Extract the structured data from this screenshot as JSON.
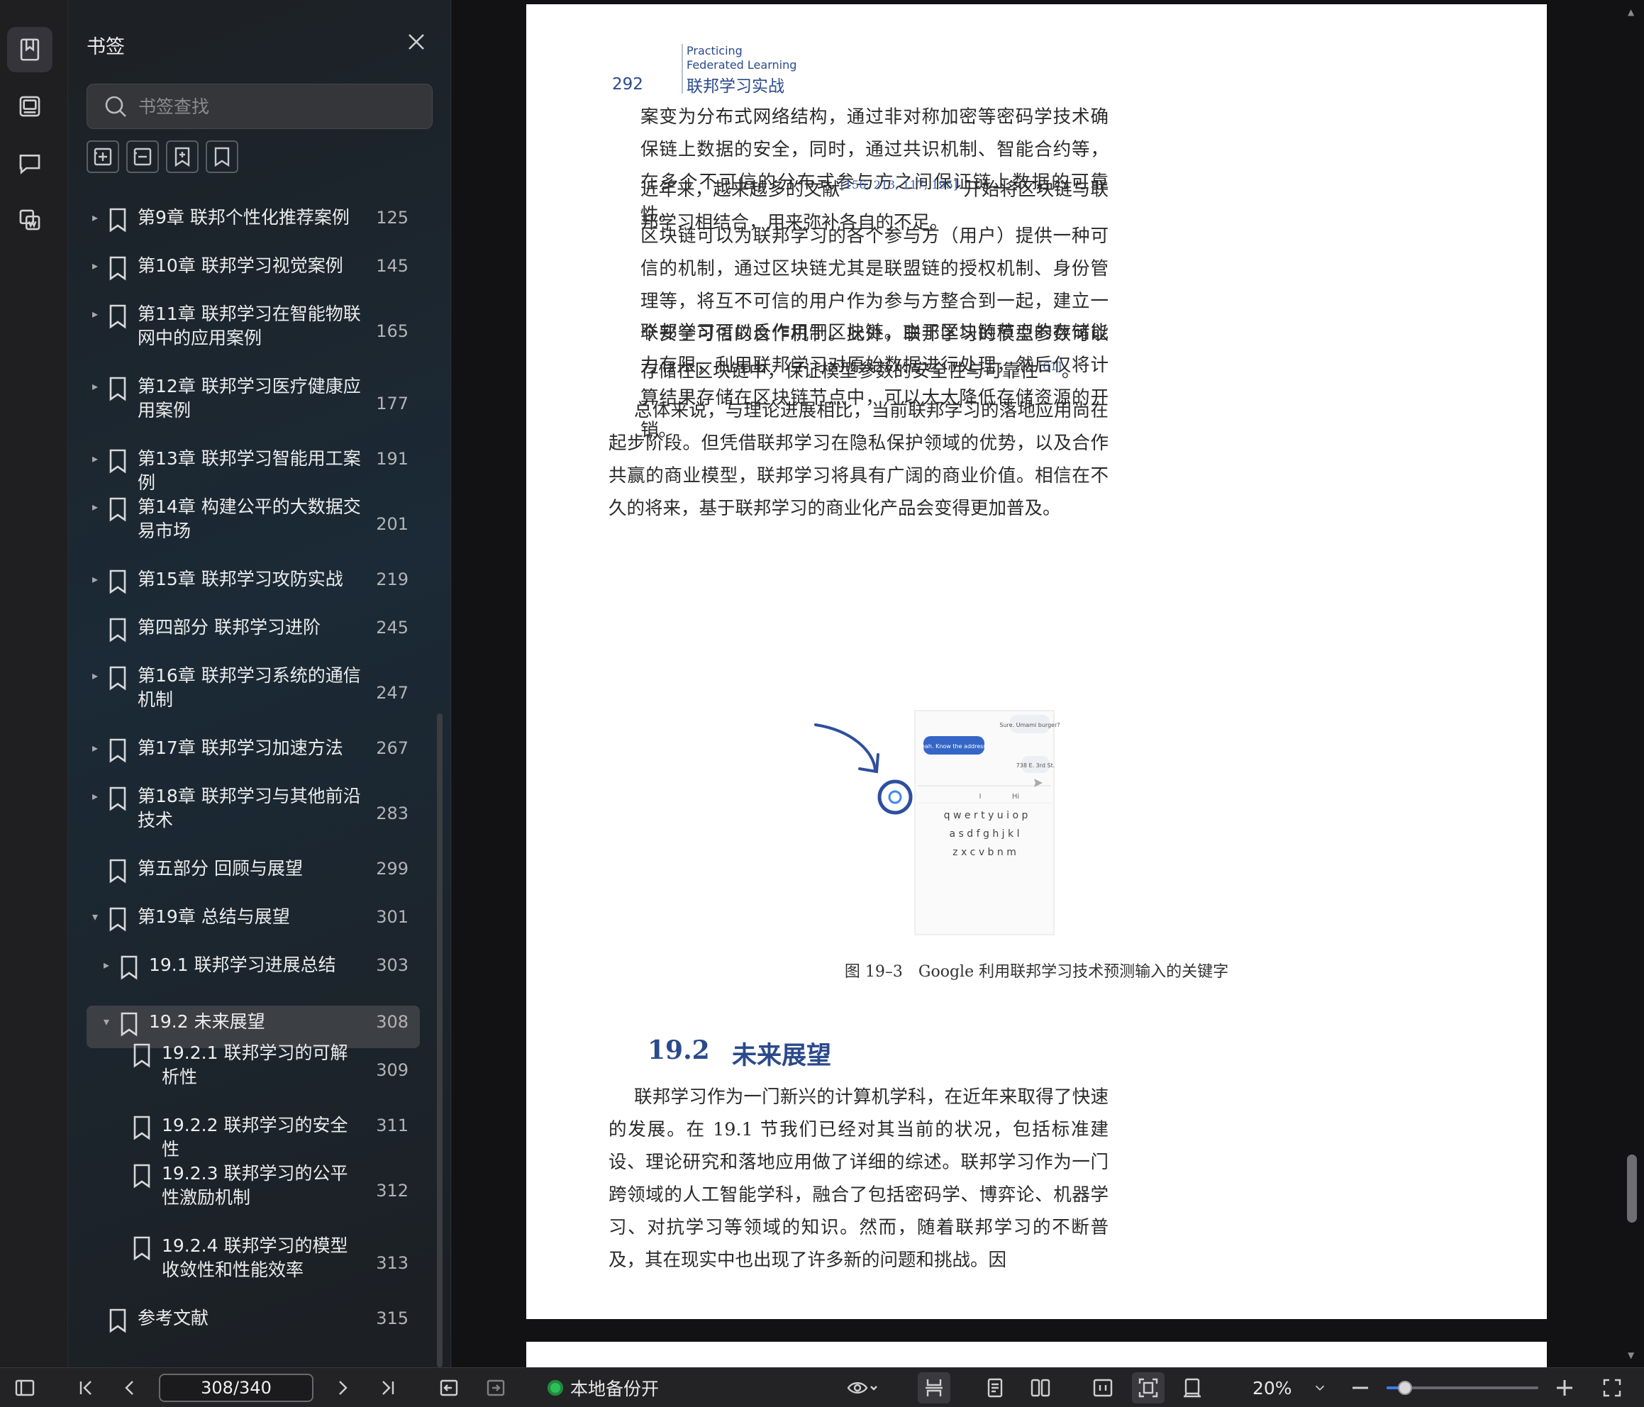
{
  "panel": {
    "title": "书签",
    "search_placeholder": "书签查找",
    "bookmarks": [
      {
        "label": "第9章 联邦个性化推荐案例",
        "page": "125",
        "arrow": "▸"
      },
      {
        "label": "第10章 联邦学习视觉案例",
        "page": "145",
        "arrow": "▸"
      },
      {
        "label": "第11章 联邦学习在智能物联网中的应用案例",
        "page": "165",
        "arrow": "▸"
      },
      {
        "label": "第12章 联邦学习医疗健康应用案例",
        "page": "177",
        "arrow": "▸"
      },
      {
        "label": "第13章 联邦学习智能用工案例",
        "page": "191",
        "arrow": "▸"
      },
      {
        "label": "第14章 构建公平的大数据交易市场",
        "page": "201",
        "arrow": "▸"
      },
      {
        "label": "第15章 联邦学习攻防实战",
        "page": "219",
        "arrow": "▸"
      },
      {
        "label": "第四部分 联邦学习进阶",
        "page": "245",
        "arrow": ""
      },
      {
        "label": "第16章 联邦学习系统的通信机制",
        "page": "247",
        "arrow": "▸"
      },
      {
        "label": "第17章 联邦学习加速方法",
        "page": "267",
        "arrow": "▸"
      },
      {
        "label": "第18章 联邦学习与其他前沿技术",
        "page": "283",
        "arrow": "▸"
      },
      {
        "label": "第五部分 回顾与展望",
        "page": "299",
        "arrow": ""
      },
      {
        "label": "第19章 总结与展望",
        "page": "301",
        "arrow": "▾"
      },
      {
        "label": "19.1 联邦学习进展总结",
        "page": "303",
        "arrow": "▸"
      },
      {
        "label": "19.2 未来展望",
        "page": "308",
        "arrow": "▾"
      },
      {
        "label": "19.2.1 联邦学习的可解析性",
        "page": "309",
        "arrow": ""
      },
      {
        "label": "19.2.2 联邦学习的安全性",
        "page": "311",
        "arrow": ""
      },
      {
        "label": "19.2.3 联邦学习的公平性激励机制",
        "page": "312",
        "arrow": ""
      },
      {
        "label": "19.2.4 联邦学习的模型收敛性和性能效率",
        "page": "313",
        "arrow": ""
      },
      {
        "label": "参考文献",
        "page": "315",
        "arrow": ""
      }
    ]
  },
  "document": {
    "page_number": "292",
    "header_en_1": "Practicing",
    "header_en_2": "Federated Learning",
    "header_zh": "联邦学习实战",
    "p1": "案变为分布式网络结构，通过非对称加密等密码学技术确保链上数据的安全，同时，通过共识机制、智能合约等，在多个不可信的分布式参与方之间保证链上数据的可靠性。",
    "p2_a": "近年来，越来越多的文献",
    "p2_ref": "[156, 213, 117, 195]",
    "p2_b": " 开始将区块链与联邦学习相结合，用来弥补各自的不足。",
    "p3_a": "区块链可以为联邦学习的各个参与方（用户）提供一种可信的机制，通过区块链尤其是联盟链的授权机制、身份管理等，将互不可信的用户作为参与方整合到一起，建立一个安全可信的合作机制。此外，联邦学习的模型参数可以存储在区块链中，保证模型参数的安全性与可靠性",
    "p3_ref": "[61]",
    "p3_b": "。",
    "p4": "联邦学习可以反作用于区块链。由于区块链节点的存储能力有限，利用联邦学习对原始数据进行处理，然后仅将计算结果存储在区块链节点中，可以大大降低存储资源的开销。",
    "p5": "总体来说，与理论进展相比，当前联邦学习的落地应用尚在起步阶段。但凭借联邦学习在隐私保护领域的优势，以及合作共赢的商业模型，联邦学习将具有广阔的商业价值。相信在不久的将来，基于联邦学习的商业化产品会变得更加普及。",
    "figure": {
      "bubble1": "Sure. Umami burger?",
      "bubble2": "Yeah. Know the address?",
      "bubble3": "738 E. 3rd St.",
      "suggest1": "I",
      "suggest2": "Hi",
      "row1": "q w e r t y u i o p",
      "row2": "a s d f g h j k l",
      "row3": "z x c v b n m"
    },
    "caption": "图 19–3　Google 利用联邦学习技术预测输入的关键字",
    "section_num": "19.2",
    "section_title": "未来展望",
    "p6": "联邦学习作为一门新兴的计算机学科，在近年来取得了快速的发展。在 19.1 节我们已经对其当前的状况，包括标准建设、理论研究和落地应用做了详细的综述。联邦学习作为一门跨领域的人工智能学科，融合了包括密码学、博弈论、机器学习、对抗学习等领域的知识。然而，随着联邦学习的不断普及，其在现实中也出现了许多新的问题和挑战。因"
  },
  "bottombar": {
    "page_field": "308/340",
    "backup_label": "本地备份开",
    "zoom_label": "20%",
    "zoom_fraction": 0.12
  },
  "colors": {
    "accent": "#3d7bf2",
    "heading_blue": "#2b4a8c",
    "backup_green": "#2fbf5a"
  }
}
